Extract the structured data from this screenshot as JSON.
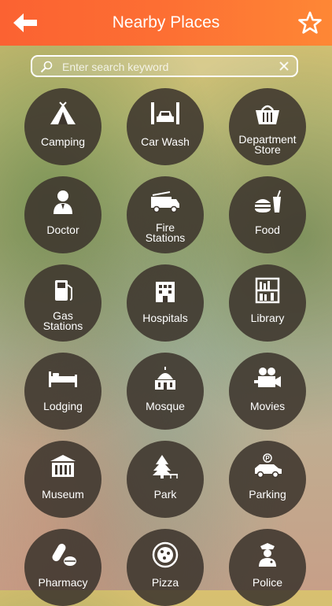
{
  "header": {
    "title": "Nearby Places",
    "back_icon": "back-arrow-icon",
    "favorite_icon": "star-icon"
  },
  "search": {
    "placeholder": "Enter search keyword",
    "value": ""
  },
  "categories": [
    {
      "label": "Camping",
      "icon": "tent-icon"
    },
    {
      "label": "Car Wash",
      "icon": "car-wash-icon"
    },
    {
      "label": "Department\nStore",
      "icon": "shopping-basket-icon"
    },
    {
      "label": "Doctor",
      "icon": "doctor-icon"
    },
    {
      "label": "Fire\nStations",
      "icon": "fire-truck-icon"
    },
    {
      "label": "Food",
      "icon": "food-icon"
    },
    {
      "label": "Gas\nStations",
      "icon": "gas-pump-icon"
    },
    {
      "label": "Hospitals",
      "icon": "hospital-icon"
    },
    {
      "label": "Library",
      "icon": "bookshelf-icon"
    },
    {
      "label": "Lodging",
      "icon": "bed-icon"
    },
    {
      "label": "Mosque",
      "icon": "mosque-icon"
    },
    {
      "label": "Movies",
      "icon": "movie-camera-icon"
    },
    {
      "label": "Museum",
      "icon": "museum-icon"
    },
    {
      "label": "Park",
      "icon": "tree-icon"
    },
    {
      "label": "Parking",
      "icon": "parking-car-icon"
    },
    {
      "label": "Pharmacy",
      "icon": "pill-icon"
    },
    {
      "label": "Pizza",
      "icon": "pizza-icon"
    },
    {
      "label": "Police",
      "icon": "police-icon"
    }
  ]
}
